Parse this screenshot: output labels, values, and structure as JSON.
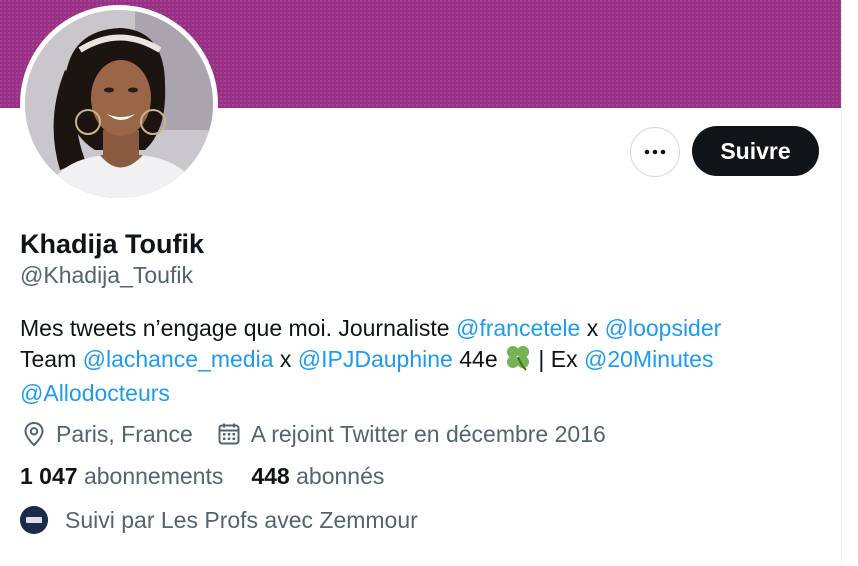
{
  "profile": {
    "name": "Khadija Toufik",
    "handle": "@Khadija_Toufik",
    "banner_color": "#9a2f86"
  },
  "actions": {
    "more_label": "•••",
    "follow_label": "Suivre"
  },
  "bio": {
    "line1_text_a": "Mes tweets n’engage que moi.  Journaliste ",
    "mention_francetele": "@francetele",
    "line1_text_b": " x ",
    "mention_loopsider": "@loopsider",
    "line2_text_a": "Team ",
    "mention_lachance": "@lachance_media",
    "line2_text_b": " x ",
    "mention_ipj": "@IPJDauphine",
    "line2_text_c": " 44e ",
    "clover_emoji": "🍀",
    "line2_text_d": " | Ex ",
    "mention_20minutes": "@20Minutes",
    "mention_allodocteurs": "@Allodocteurs"
  },
  "meta": {
    "location_icon": "location-pin-icon",
    "location": "Paris, France",
    "calendar_icon": "calendar-icon",
    "joined": "A rejoint Twitter en décembre 2016"
  },
  "stats": {
    "following_count": "1 047",
    "following_label": "abonnements",
    "followers_count": "448",
    "followers_label": "abonnés"
  },
  "followed_by": {
    "text": "Suivi par Les Profs avec Zemmour"
  },
  "colors": {
    "link": "#1d9bf0",
    "secondary_text": "#536471",
    "primary_text": "#0f1419",
    "follow_button_bg": "#0f1419"
  }
}
